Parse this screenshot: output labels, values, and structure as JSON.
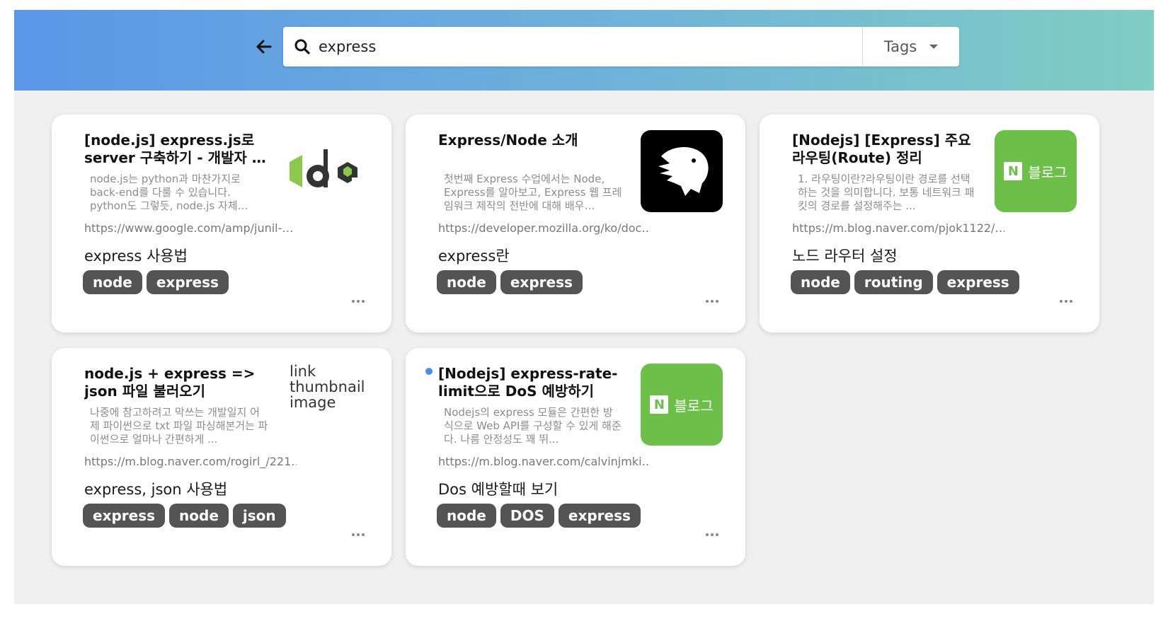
{
  "search": {
    "value": "express",
    "tags_label": "Tags"
  },
  "cards": [
    {
      "title": "[node.js] express.js로 server 구축하기 - 개발자 …",
      "desc": "node.js는 python과 마찬가지로 back-end를 다룰 수 있습니다. python도 그렇듯, node.js 자체…",
      "url": "https://www.google.com/amp/junil-…",
      "memo": "express 사용법",
      "tags": [
        "node",
        "express"
      ],
      "thumb": "node-logo"
    },
    {
      "title": "Express/Node 소개",
      "desc": "첫번째 Express 수업에서는 Node, Express를 알아보고, Express 웹 프레임워크 제작의 전반에 대해 배우…",
      "url": "https://developer.mozilla.org/ko/doc…",
      "memo": "express란",
      "tags": [
        "node",
        "express"
      ],
      "thumb": "mdn-dino"
    },
    {
      "title": "[Nodejs] [Express] 주요 라우팅(Route) 정리",
      "desc": "1. 라우팅이란?라우팅이란 경로를 선택하는 것을 의미합니다. 보통 네트워크 패킷의 경로를 설정해주는 ...",
      "url": "https://m.blog.naver.com/pjok1122/…",
      "memo": "노드 라우터 설정",
      "tags": [
        "node",
        "routing",
        "express"
      ],
      "thumb": "naver-blog",
      "thumb_n": "N",
      "thumb_label": "블로그"
    },
    {
      "title": "node.js + express => json 파일 불러오기",
      "desc": "나중에 참고하려고 막쓰는 개발일지 어제 파이썬으로 txt 파일 파싱해본거는 파이썬으로 얼마나 간편하게 ...",
      "url": "https://m.blog.naver.com/rogirl_/221…",
      "memo": "express, json 사용법",
      "tags": [
        "express",
        "node",
        "json"
      ],
      "thumb": "broken-image",
      "thumb_alt": "link thumbnail image"
    },
    {
      "title": "[Nodejs] express-rate-limit으로 DoS 예방하기",
      "desc": "Nodejs의 express 모듈은 간편한 방식으로 Web API를 구성할 수 있게 해준다. 나름 안정성도 꽤 뛰...",
      "url": "https://m.blog.naver.com/calvinjmki…",
      "memo": "Dos 예방할때 보기",
      "tags": [
        "node",
        "DOS",
        "express"
      ],
      "thumb": "naver-blog",
      "thumb_n": "N",
      "thumb_label": "블로그",
      "unread": true
    }
  ],
  "colors": {
    "accent": "#5b96e8",
    "tag_bg": "#545454",
    "naver_green": "#6cc04a",
    "unread_dot": "#4a8ef0"
  }
}
